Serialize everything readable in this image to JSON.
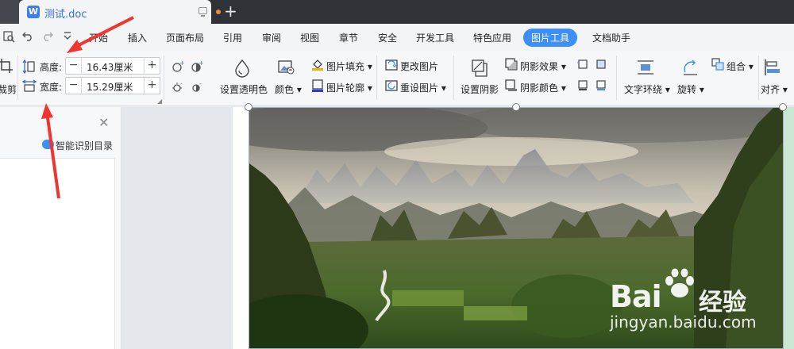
{
  "titlebar": {
    "doc_title": "测试.doc",
    "doc_icon": "W"
  },
  "menu": {
    "items": [
      "开始",
      "插入",
      "页面布局",
      "引用",
      "审阅",
      "视图",
      "章节",
      "安全",
      "开发工具",
      "特色应用",
      "图片工具",
      "文档助手"
    ],
    "active": "图片工具"
  },
  "ribbon": {
    "crop_label": "裁剪",
    "height_label": "高度:",
    "height_value": "16.43厘米",
    "width_label": "宽度:",
    "width_value": "15.29厘米",
    "set_transparent": "设置透明色",
    "color": "颜色",
    "picture_fill": "图片填充",
    "picture_outline": "图片轮廓",
    "change_picture": "更改图片",
    "reset_picture": "重设图片",
    "set_shadow": "设置阴影",
    "shadow_effect": "阴影效果",
    "shadow_color": "阴影颜色",
    "text_wrap": "文字环绕",
    "rotate": "旋转",
    "group": "组合",
    "align": "对齐"
  },
  "nav_pane": {
    "toc_label": "智能识别目录"
  },
  "watermark": {
    "brand": "Bai",
    "brand_cn": "经验",
    "url": "jingyan.baidu.com"
  },
  "colors": {
    "accent": "#3e8ef7",
    "titlebar": "#2f3338",
    "arrow": "#f0352f"
  },
  "icons": [
    "word-doc-icon",
    "screen-icon",
    "new-tab-icon",
    "undo-icon",
    "redo-icon",
    "dropdown-icon",
    "height-icon",
    "width-icon",
    "transparent-icon",
    "color-icon",
    "fill-icon",
    "outline-icon",
    "change-picture-icon",
    "reset-picture-icon",
    "shadow-icon",
    "text-wrap-icon",
    "rotate-icon",
    "group-icon",
    "align-icon",
    "close-icon"
  ]
}
